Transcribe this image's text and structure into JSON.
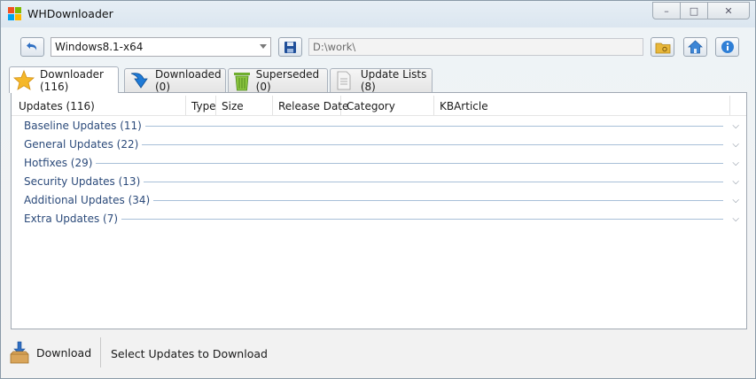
{
  "window": {
    "title": "WHDownloader",
    "controls": {
      "minimize": "–",
      "maximize": "□",
      "close": "✕"
    }
  },
  "toolbar": {
    "os_selected": "Windows8.1-x64",
    "path": "D:\\work\\",
    "icons": [
      "undo-icon",
      "save-icon",
      "folder-icon",
      "home-icon",
      "info-icon"
    ]
  },
  "tabs": [
    {
      "label": "Downloader (116)",
      "icon": "star-icon",
      "active": true
    },
    {
      "label": "Downloaded (0)",
      "icon": "download-arrow-icon",
      "active": false
    },
    {
      "label": "Superseded (0)",
      "icon": "trash-icon",
      "active": false
    },
    {
      "label": "Update Lists (8)",
      "icon": "document-icon",
      "active": false
    }
  ],
  "columns": [
    "Updates (116)",
    "Type",
    "Size",
    "Release Date",
    "Category",
    "KBArticle"
  ],
  "groups": [
    "Baseline Updates (11)",
    "General Updates (22)",
    "Hotfixes (29)",
    "Security Updates (13)",
    "Additional Updates (34)",
    "Extra Updates (7)"
  ],
  "status": {
    "download_label": "Download",
    "message": "Select Updates to Download"
  },
  "colors": {
    "group_text": "#2b4a7a",
    "group_line": "#a8bfd8",
    "accent_blue": "#2f6fc2"
  }
}
